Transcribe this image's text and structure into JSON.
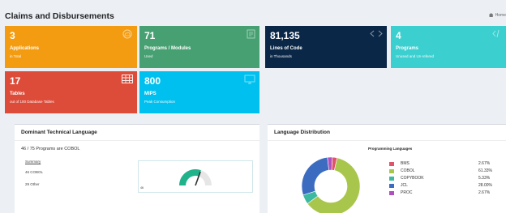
{
  "header": {
    "title": "Claims and Disbursements",
    "breadcrumb": "Home"
  },
  "tiles": [
    {
      "value": "3",
      "label": "Applications",
      "sub": "in Total",
      "color": "#f39c12",
      "icon": "cloud-icon"
    },
    {
      "value": "71",
      "label": "Programs / Modules",
      "sub": "Used",
      "color": "#46a071",
      "icon": "document-icon"
    },
    {
      "value": "81,135",
      "label": "Lines of Code",
      "sub": "in Thousands",
      "color": "#0b2748",
      "icon": "code-icon"
    },
    {
      "value": "4",
      "label": "Programs",
      "sub": "Unused and Un-refered",
      "color": "#3ccfcf",
      "icon": "code-slash-icon"
    },
    {
      "value": "17",
      "label": "Tables",
      "sub": "out of 100 Database Tables",
      "color": "#dd4b39",
      "icon": "table-grid-icon"
    },
    {
      "value": "800",
      "label": "MIPS",
      "sub": "Peak Consumption",
      "color": "#00c0ef",
      "icon": "monitor-icon"
    }
  ],
  "dominant": {
    "title": "Dominant Technical Language",
    "headline": "46 / 75 Programs are COBOL",
    "summary_link": "Summary",
    "line1": "46 COBOL",
    "line2": "29 Other",
    "gauge_label": "46",
    "gauge_fraction": 0.61,
    "gauge_color": "#20b28b"
  },
  "distribution": {
    "title": "Language Distribution",
    "chart_title": "Programming Languages"
  },
  "chart_data": {
    "type": "pie",
    "title": "Programming Languages",
    "series": [
      {
        "name": "BMS",
        "value": 2.67,
        "label": "2.67%",
        "color": "#e0546b"
      },
      {
        "name": "COBOL",
        "value": 61.33,
        "label": "61.33%",
        "color": "#a8c64b"
      },
      {
        "name": "COPYBOOK",
        "value": 5.33,
        "label": "5.33%",
        "color": "#3cb9a0"
      },
      {
        "name": "JCL",
        "value": 28.0,
        "label": "28.00%",
        "color": "#3c6cc0"
      },
      {
        "name": "PROC",
        "value": 2.67,
        "label": "2.67%",
        "color": "#b04fbf"
      }
    ]
  }
}
